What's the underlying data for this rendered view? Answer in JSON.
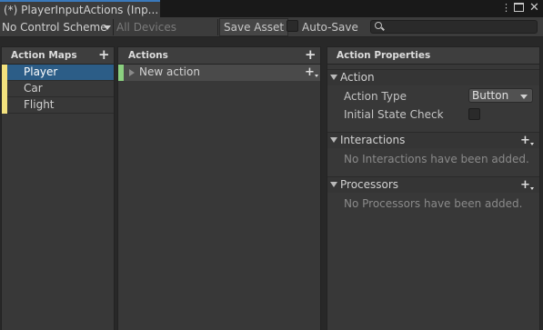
{
  "window": {
    "tab_title": "(*) PlayerInputActions (Inp...",
    "menu_icon": "kebab-menu-icon",
    "maximize_icon": "maximize-icon",
    "close_icon": "close-icon"
  },
  "toolbar": {
    "control_scheme": "No Control Scheme",
    "devices": "All Devices",
    "save_asset": "Save Asset",
    "auto_save": "Auto-Save",
    "auto_save_checked": false,
    "search_value": ""
  },
  "action_maps": {
    "header": "Action Maps",
    "stripe_color": "#f3e27e",
    "selected_color": "#2c5d87",
    "items": [
      {
        "label": "Player",
        "selected": true
      },
      {
        "label": "Car",
        "selected": false
      },
      {
        "label": "Flight",
        "selected": false
      }
    ]
  },
  "actions": {
    "header": "Actions",
    "stripe_color": "#8bd080",
    "items": [
      {
        "label": "New action"
      }
    ]
  },
  "properties": {
    "header": "Action Properties",
    "action_section": "Action",
    "action_type_label": "Action Type",
    "action_type_value": "Button",
    "initial_state_check_label": "Initial State Check",
    "initial_state_check": false,
    "interactions_section": "Interactions",
    "interactions_empty": "No Interactions have been added.",
    "processors_section": "Processors",
    "processors_empty": "No Processors have been added."
  }
}
